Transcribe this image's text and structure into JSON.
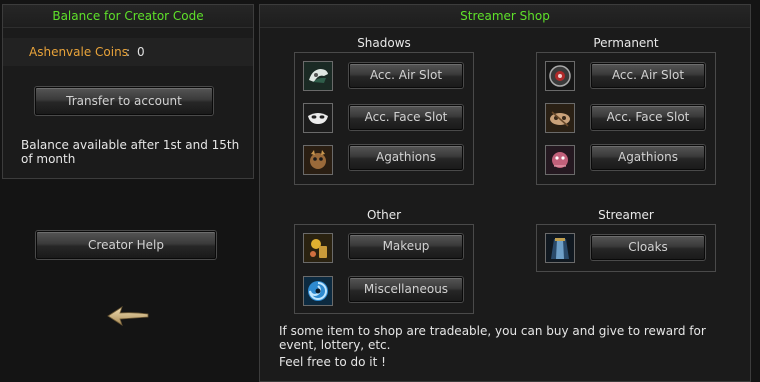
{
  "left": {
    "title": "Balance for Creator Code",
    "coins_label": "Ashenvale Coins",
    "coins_sep": ":",
    "coins_value": "0",
    "transfer_button": "Transfer to account",
    "note": "Balance available after 1st and 15th of month",
    "help_button": "Creator Help"
  },
  "shop": {
    "title": "Streamer Shop",
    "shadows": {
      "title": "Shadows",
      "items": [
        "Acc. Air Slot",
        "Acc. Face Slot",
        "Agathions"
      ]
    },
    "permanent": {
      "title": "Permanent",
      "items": [
        "Acc. Air Slot",
        "Acc. Face Slot",
        "Agathions"
      ]
    },
    "other": {
      "title": "Other",
      "items": [
        "Makeup",
        "Miscellaneous"
      ]
    },
    "streamer": {
      "title": "Streamer",
      "items": [
        "Cloaks"
      ]
    },
    "info_line1": "If some item to shop are tradeable, you can buy and give to reward for event, lottery, etc.",
    "info_line2": "Feel free to do it !"
  },
  "colors": {
    "title_green": "#5ee02a",
    "coins_orange": "#e8a33a"
  },
  "icons": [
    "hat-icon",
    "mask-icon",
    "agathion-icon",
    "cosmetic-icon",
    "vortex-icon",
    "cloak-icon",
    "back-arrow-icon"
  ]
}
